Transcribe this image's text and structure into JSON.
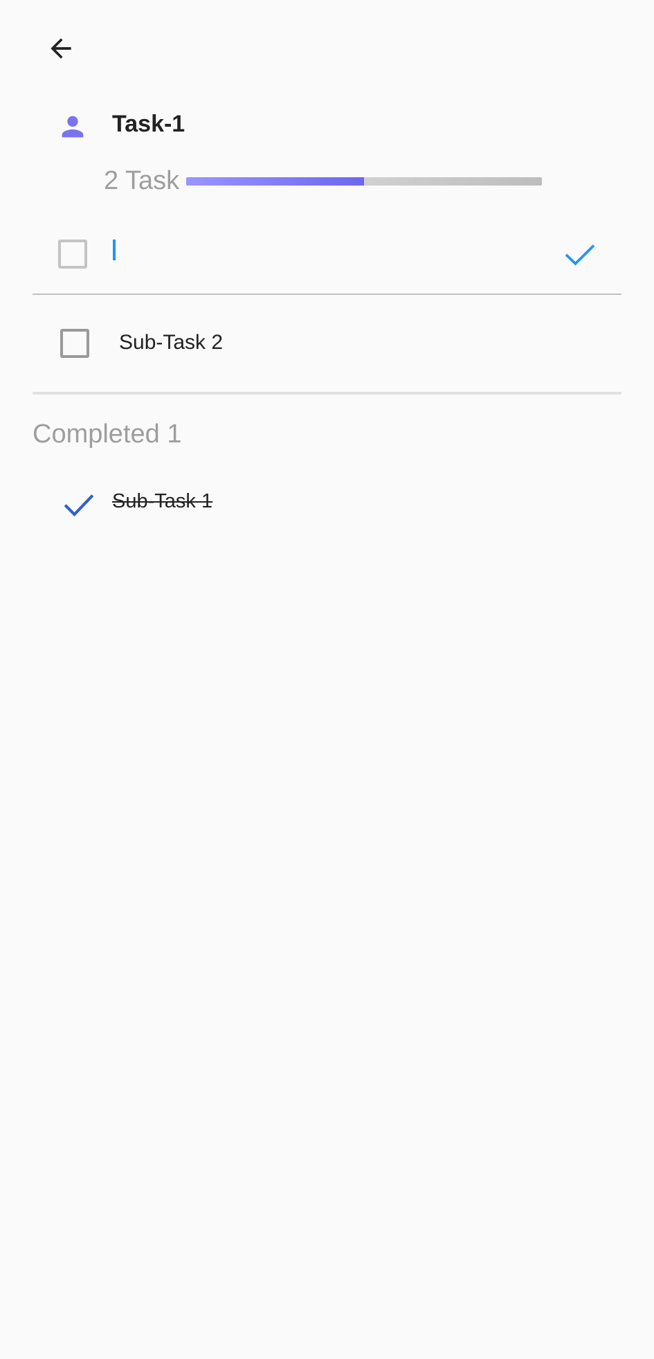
{
  "task": {
    "title": "Task-1",
    "icon": "person-icon",
    "accent_color": "#7a73ef"
  },
  "progress": {
    "label": "2 Task",
    "fraction": 0.5
  },
  "new_subtask": {
    "value": "",
    "placeholder": ""
  },
  "subtasks": [
    {
      "label": "Sub-Task 2",
      "checked": false
    }
  ],
  "completed": {
    "heading": "Completed 1",
    "items": [
      {
        "label": "Sub-Task 1",
        "checked": true
      }
    ]
  },
  "colors": {
    "check_blue": "#2196f3",
    "done_check": "#2f5fd0"
  }
}
